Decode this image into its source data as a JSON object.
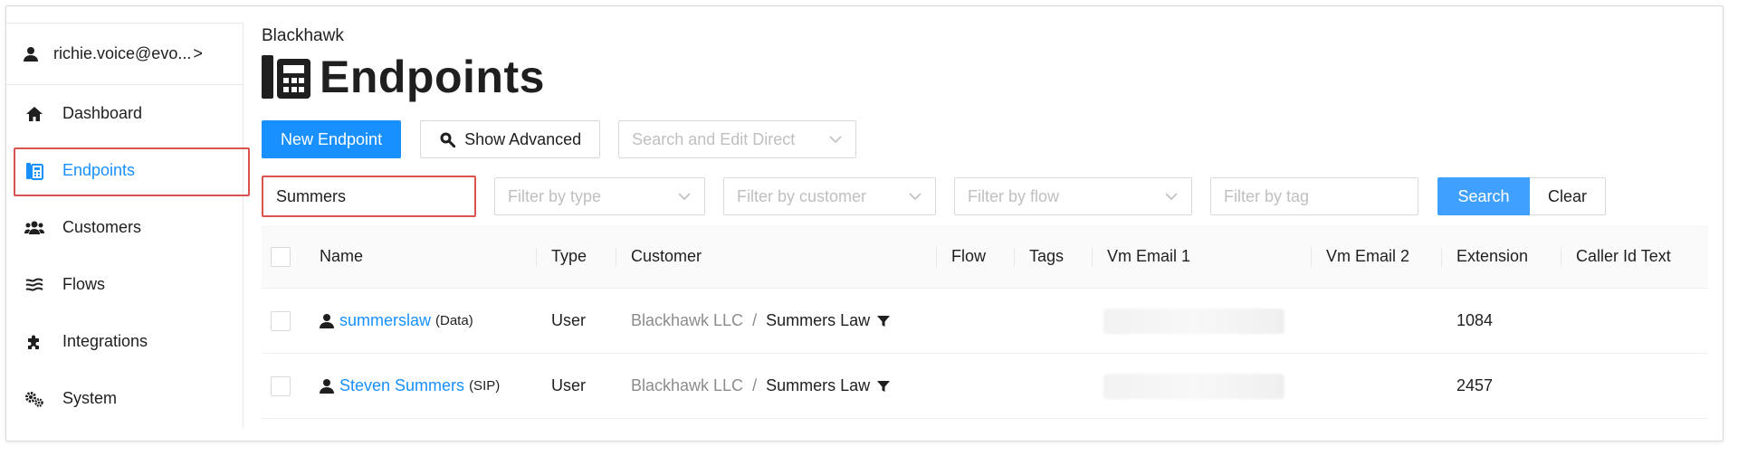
{
  "sidebar": {
    "user": {
      "label": "richie.voice@evo...",
      "chevron": ">"
    },
    "items": [
      {
        "label": "Dashboard",
        "icon": "home-icon"
      },
      {
        "label": "Endpoints",
        "icon": "endpoints-icon",
        "active": true
      },
      {
        "label": "Customers",
        "icon": "customers-icon"
      },
      {
        "label": "Flows",
        "icon": "flows-icon"
      },
      {
        "label": "Integrations",
        "icon": "puzzle-icon"
      },
      {
        "label": "System",
        "icon": "gears-icon"
      }
    ]
  },
  "header": {
    "org": "Blackhawk",
    "title": "Endpoints"
  },
  "toolbar": {
    "new_endpoint": "New Endpoint",
    "show_advanced": "Show Advanced",
    "search_edit_direct": "Search and Edit Direct"
  },
  "filters": {
    "search_value": "Summers",
    "type_placeholder": "Filter by type",
    "customer_placeholder": "Filter by customer",
    "flow_placeholder": "Filter by flow",
    "tag_placeholder": "Filter by tag",
    "search_button": "Search",
    "clear_button": "Clear"
  },
  "table": {
    "columns": [
      "Name",
      "Type",
      "Customer",
      "Flow",
      "Tags",
      "Vm Email 1",
      "Vm Email 2",
      "Extension",
      "Caller Id Text"
    ],
    "rows": [
      {
        "name": "summerslaw",
        "name_suffix": "(Data)",
        "type": "User",
        "customer_parent": "Blackhawk LLC",
        "customer_child": "Summers Law",
        "extension": "1084"
      },
      {
        "name": "Steven Summers",
        "name_suffix": "(SIP)",
        "type": "User",
        "customer_parent": "Blackhawk LLC",
        "customer_child": "Summers Law",
        "extension": "2457"
      }
    ]
  },
  "colors": {
    "accent": "#1890ff",
    "highlight_border": "#d9534f"
  }
}
